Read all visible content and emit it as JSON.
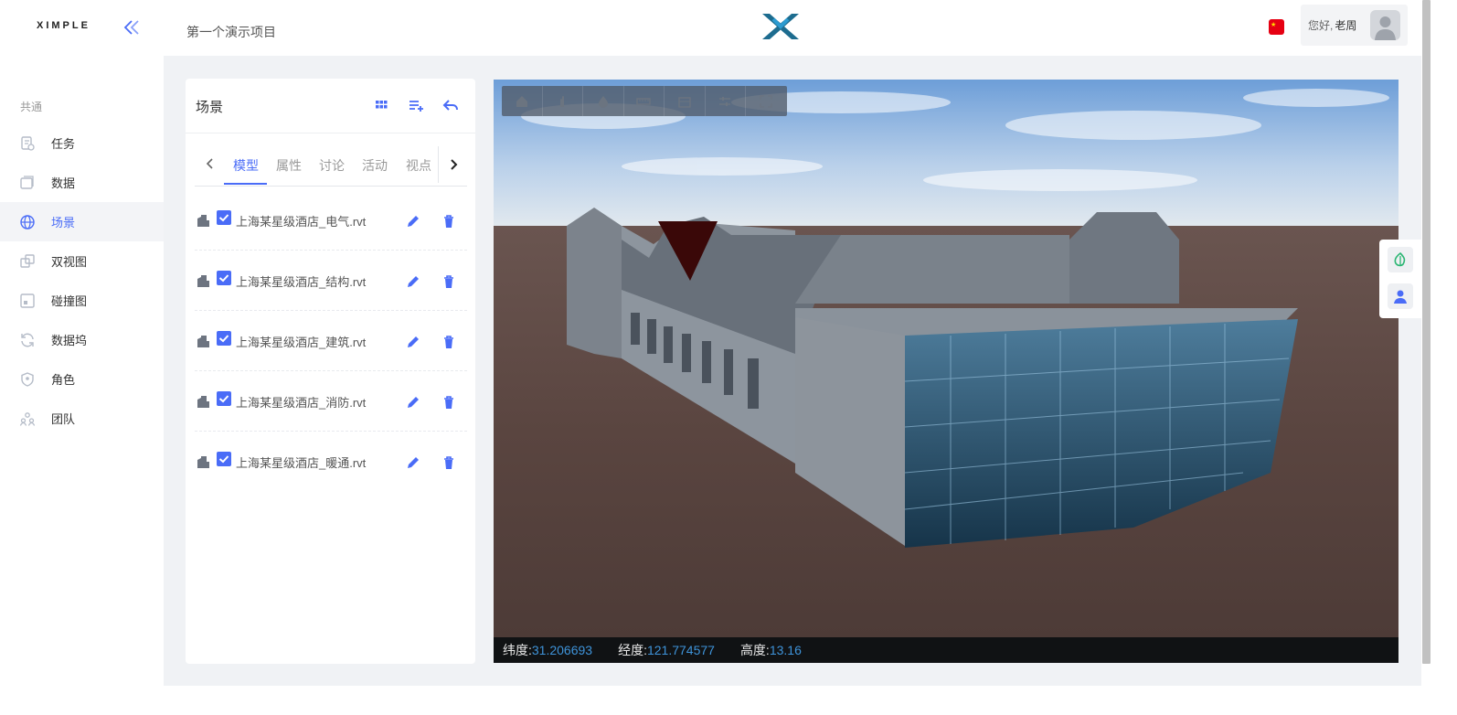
{
  "app": {
    "brand": "XIMPLE",
    "project_name": "第一个演示项目"
  },
  "user": {
    "greeting": "您好,",
    "name": "老周"
  },
  "sidebar": {
    "section": "共通",
    "items": [
      {
        "label": "任务",
        "icon": "task-icon"
      },
      {
        "label": "数据",
        "icon": "data-icon"
      },
      {
        "label": "场景",
        "icon": "globe-icon",
        "active": true
      },
      {
        "label": "双视图",
        "icon": "dual-view-icon"
      },
      {
        "label": "碰撞图",
        "icon": "collision-icon"
      },
      {
        "label": "数据坞",
        "icon": "refresh-icon"
      },
      {
        "label": "角色",
        "icon": "shield-icon"
      },
      {
        "label": "团队",
        "icon": "team-icon"
      }
    ]
  },
  "panel": {
    "title": "场景",
    "tabs": [
      "模型",
      "属性",
      "讨论",
      "活动",
      "视点"
    ],
    "active_tab": "模型",
    "models": [
      {
        "name": "上海某星级酒店_电气.rvt",
        "checked": true
      },
      {
        "name": "上海某星级酒店_结构.rvt",
        "checked": true
      },
      {
        "name": "上海某星级酒店_建筑.rvt",
        "checked": true
      },
      {
        "name": "上海某星级酒店_消防.rvt",
        "checked": true
      },
      {
        "name": "上海某星级酒店_暖通.rvt",
        "checked": true
      }
    ]
  },
  "viewer": {
    "toolbar": [
      "home-icon",
      "pan-icon",
      "style-icon",
      "measure-icon",
      "section-box-icon",
      "settings-sliders-icon",
      "fullscreen-icon"
    ],
    "coords": {
      "lat_label": "纬度:",
      "lat": "31.206693",
      "lng_label": "经度:",
      "lng": "121.774577",
      "alt_label": "高度:",
      "alt": "13.16"
    }
  },
  "colors": {
    "accent": "#4a6cf7",
    "coord_value": "#3e93d9",
    "flag": "#e60012"
  }
}
